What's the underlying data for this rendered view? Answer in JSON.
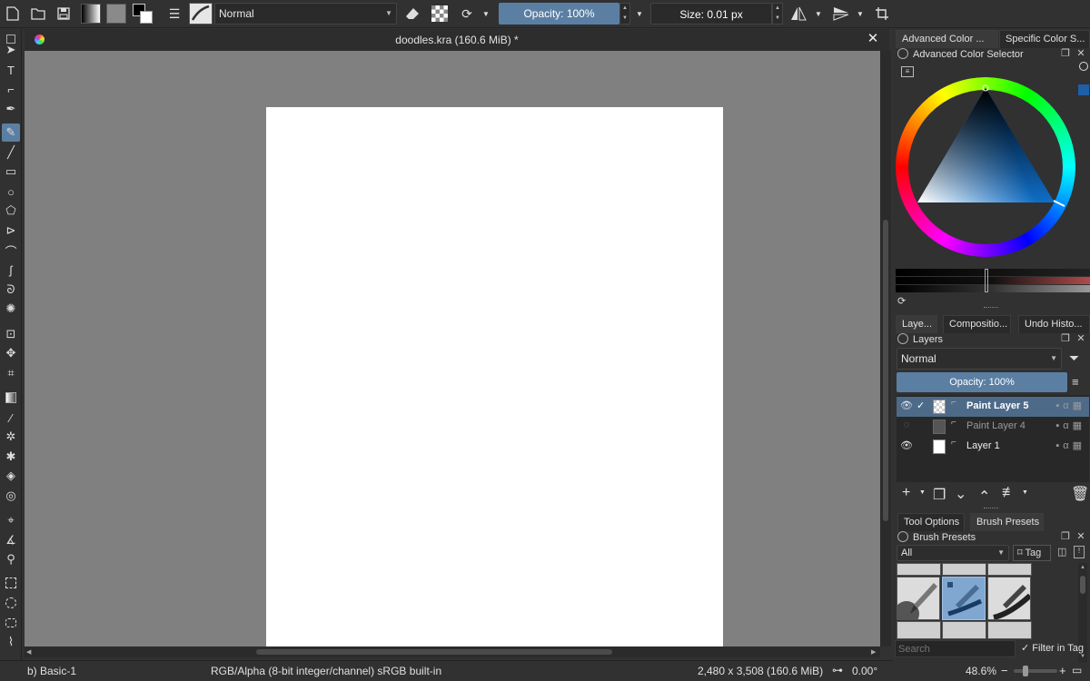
{
  "toolbar": {
    "blend_mode": "Normal",
    "opacity": "Opacity: 100%",
    "size": "Size: 0.01 px"
  },
  "document": {
    "title": "doodles.kra (160.6 MiB) *"
  },
  "dock": {
    "color_tabs": [
      "Advanced Color ...",
      "Specific Color S..."
    ],
    "color_panel_title": "Advanced Color Selector",
    "layer_tabs": [
      "Laye...",
      "Compositio...",
      "Undo Histo..."
    ],
    "layers_title": "Layers",
    "layers_blend_mode": "Normal",
    "layers_opacity": "Opacity:  100%",
    "layers": [
      {
        "name": "Paint Layer 5",
        "selected": true,
        "visible": true,
        "checked": true
      },
      {
        "name": "Paint Layer 4",
        "selected": false,
        "visible": false,
        "checked": false
      },
      {
        "name": "Layer 1",
        "selected": false,
        "visible": true,
        "checked": false
      }
    ],
    "brush_tabs": [
      "Tool Options",
      "Brush Presets"
    ],
    "brush_title": "Brush Presets",
    "brush_filter": "All",
    "tag_label": "Tag",
    "search_placeholder": "Search",
    "filter_in_tag": "Filter in Tag"
  },
  "status": {
    "preset": "b) Basic-1",
    "color_space": "RGB/Alpha (8-bit integer/channel)  sRGB built-in",
    "dimensions": "2,480 x 3,508 (160.6 MiB)",
    "rotation": "0.00°",
    "zoom": "48.6%"
  },
  "colors": {
    "accent": "#5b7fa3",
    "canvas_bg": "#808080",
    "panel_bg": "#313131"
  }
}
